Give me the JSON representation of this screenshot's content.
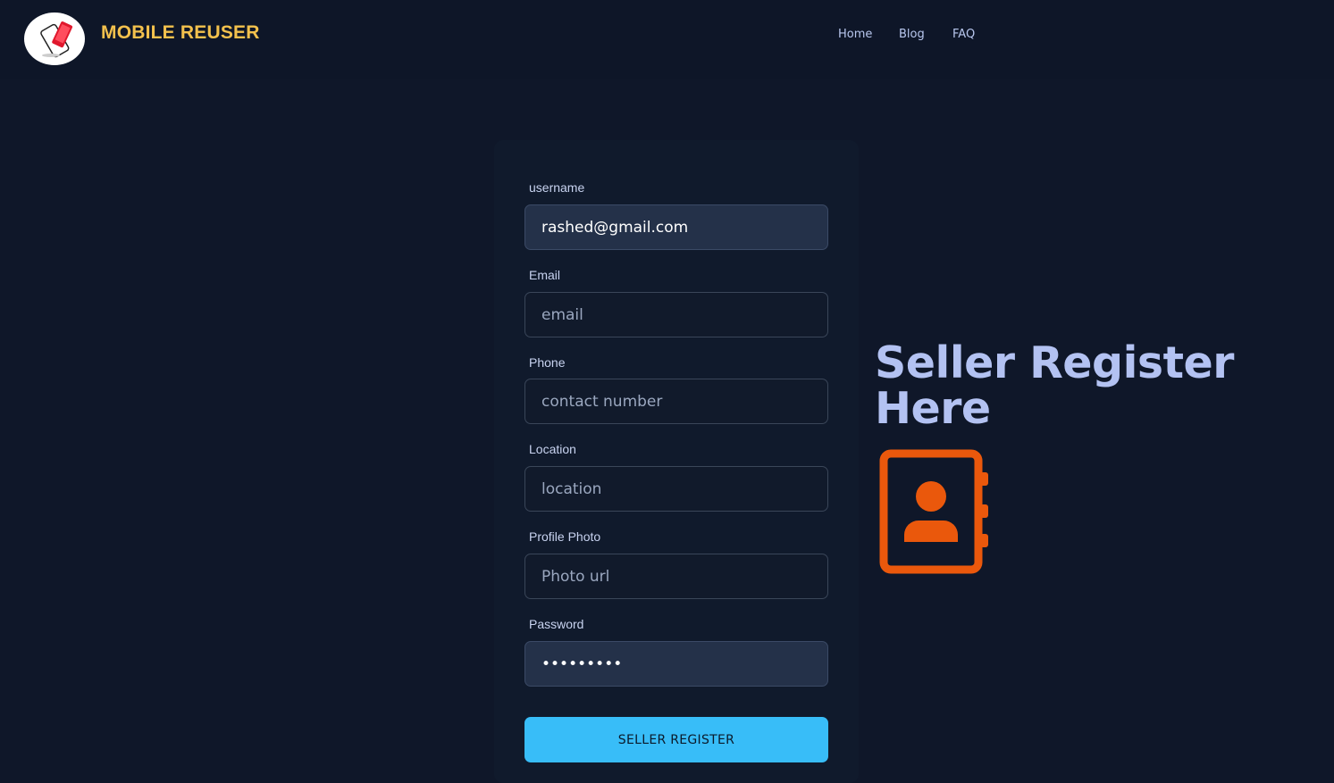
{
  "brand": {
    "name": "MOBILE REUSER",
    "logo_icon": "phone-recycle-logo"
  },
  "nav": {
    "items": [
      "Home",
      "Blog",
      "FAQ"
    ]
  },
  "form": {
    "fields": [
      {
        "label": "username",
        "value": "rashed@gmail.com",
        "placeholder": ""
      },
      {
        "label": "Email",
        "value": "",
        "placeholder": "email"
      },
      {
        "label": "Phone",
        "value": "",
        "placeholder": "contact number"
      },
      {
        "label": "Location",
        "value": "",
        "placeholder": "location"
      },
      {
        "label": "Profile Photo",
        "value": "",
        "placeholder": "Photo url"
      },
      {
        "label": "Password",
        "value": "•••••••••",
        "placeholder": ""
      }
    ],
    "submit_label": "SELLER REGISTER"
  },
  "hero": {
    "title": "Seller Register Here",
    "icon": "contact-book-icon"
  },
  "colors": {
    "background": "#0f1729",
    "brand": "#f3c14d",
    "accent": "#38bdf8",
    "icon": "#ea580c",
    "heading": "#b3c2f2"
  }
}
